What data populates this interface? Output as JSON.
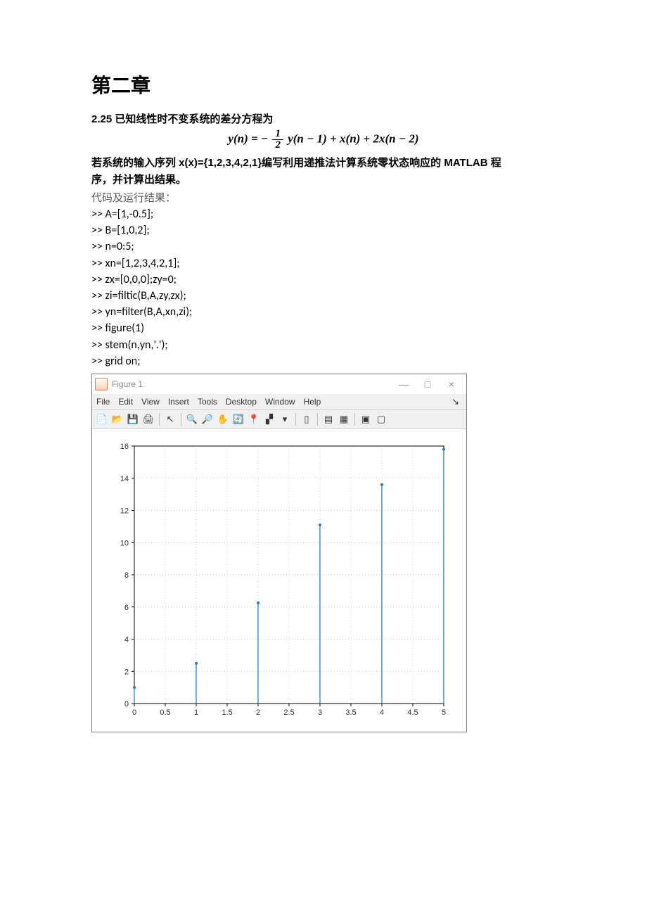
{
  "chapter_title": "第二章",
  "problem_heading": "2.25 已知线性时不变系统的差分方程为",
  "formula": {
    "left": "y(n) = −",
    "frac_num": "1",
    "frac_den": "2",
    "right": "y(n − 1) + x(n) + 2x(n − 2)"
  },
  "desc_line1": "若系统的输入序列 x(x)={1,2,3,4,2,1}编写利用递推法计算系统零状态响应的 MATLAB 程",
  "desc_line2": "序，并计算出结果。",
  "subhead": "代码及运行结果：",
  "code_lines": [
    ">> A=[1,-0.5];",
    ">> B=[1,0,2];",
    ">> n=0:5;",
    ">> xn=[1,2,3,4,2,1];",
    ">> zx=[0,0,0];zy=0;",
    ">> zi=filtic(B,A,zy,zx);",
    ">> yn=filter(B,A,xn,zi);",
    ">> figure(1)",
    ">> stem(n,yn,'.');",
    ">> grid on;"
  ],
  "figure_window": {
    "title": "Figure 1",
    "menu": [
      "File",
      "Edit",
      "View",
      "Insert",
      "Tools",
      "Desktop",
      "Window",
      "Help"
    ],
    "win_buttons": {
      "min": "—",
      "max": "□",
      "close": "×"
    }
  },
  "chart_data": {
    "type": "stem",
    "x": [
      0,
      1,
      2,
      3,
      4,
      5
    ],
    "y": [
      1.0,
      2.5,
      6.25,
      11.1,
      13.6,
      15.8
    ],
    "xlabel": "",
    "ylabel": "",
    "title": "",
    "xlim": [
      0,
      5
    ],
    "ylim": [
      0,
      16
    ],
    "xticks": [
      0,
      0.5,
      1,
      1.5,
      2,
      2.5,
      3,
      3.5,
      4,
      4.5,
      5
    ],
    "yticks": [
      0,
      2,
      4,
      6,
      8,
      10,
      12,
      14,
      16
    ],
    "grid": true,
    "marker_color": "#1f77c9",
    "line_color": "#1f77c9"
  }
}
